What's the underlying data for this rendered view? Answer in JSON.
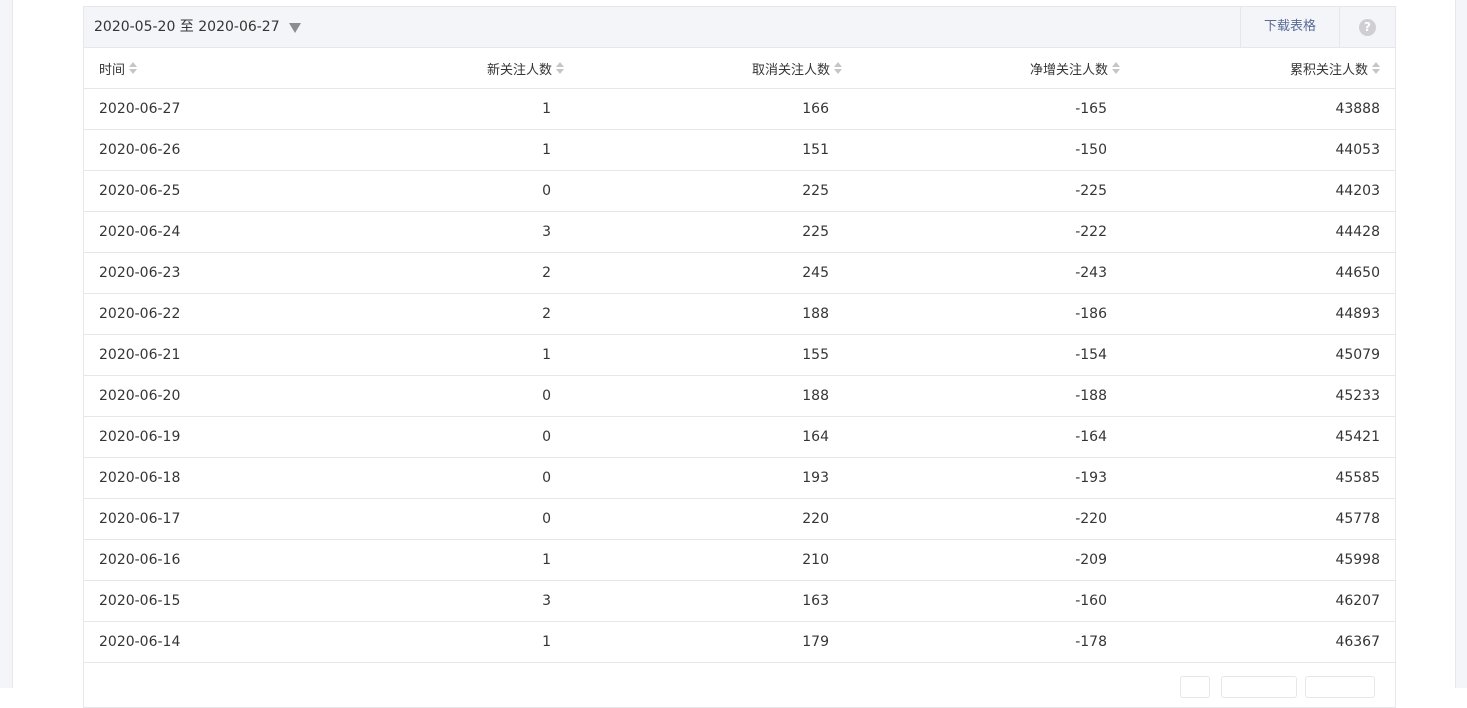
{
  "toolbar": {
    "date_range": "2020-05-20 至 2020-06-27",
    "download_label": "下载表格",
    "help_glyph": "?"
  },
  "table": {
    "columns": [
      "时间",
      "新关注人数",
      "取消关注人数",
      "净增关注人数",
      "累积关注人数"
    ],
    "rows": [
      [
        "2020-06-27",
        "1",
        "166",
        "-165",
        "43888"
      ],
      [
        "2020-06-26",
        "1",
        "151",
        "-150",
        "44053"
      ],
      [
        "2020-06-25",
        "0",
        "225",
        "-225",
        "44203"
      ],
      [
        "2020-06-24",
        "3",
        "225",
        "-222",
        "44428"
      ],
      [
        "2020-06-23",
        "2",
        "245",
        "-243",
        "44650"
      ],
      [
        "2020-06-22",
        "2",
        "188",
        "-186",
        "44893"
      ],
      [
        "2020-06-21",
        "1",
        "155",
        "-154",
        "45079"
      ],
      [
        "2020-06-20",
        "0",
        "188",
        "-188",
        "45233"
      ],
      [
        "2020-06-19",
        "0",
        "164",
        "-164",
        "45421"
      ],
      [
        "2020-06-18",
        "0",
        "193",
        "-193",
        "45585"
      ],
      [
        "2020-06-17",
        "0",
        "220",
        "-220",
        "45778"
      ],
      [
        "2020-06-16",
        "1",
        "210",
        "-209",
        "45998"
      ],
      [
        "2020-06-15",
        "3",
        "163",
        "-160",
        "46207"
      ],
      [
        "2020-06-14",
        "1",
        "179",
        "-178",
        "46367"
      ]
    ]
  },
  "icons": {
    "date_dropdown": "caret-down-icon",
    "help": "question-circle-icon",
    "sort": "sort-icon"
  },
  "colors": {
    "toolbar_bg": "#f4f5f9",
    "border": "#e7e7eb",
    "link": "#576b95",
    "text": "#353535"
  }
}
